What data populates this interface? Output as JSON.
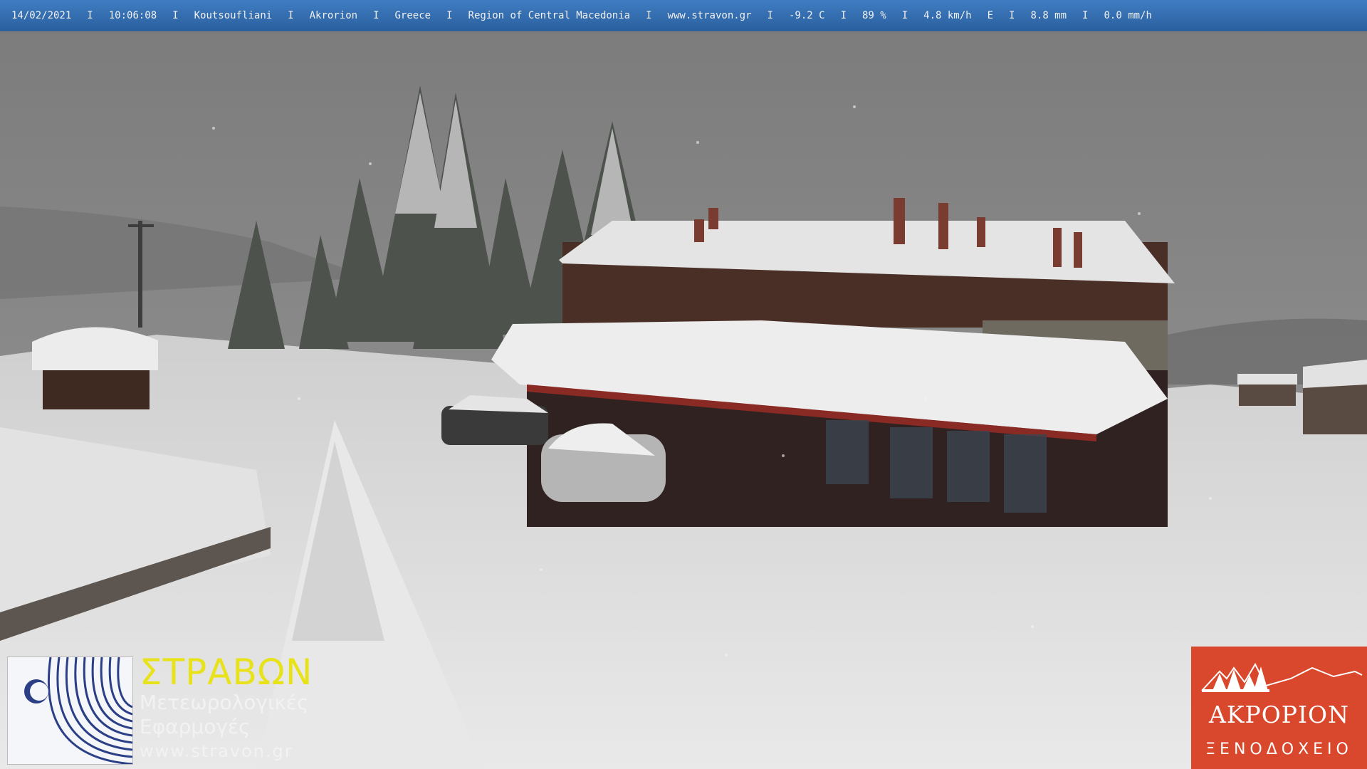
{
  "overlay": {
    "date": "14/02/2021",
    "time": "10:06:08",
    "village": "Koutsoufliani",
    "station": "Akrorion",
    "country": "Greece",
    "region": "Region of Central Macedonia",
    "website": "www.stravon.gr",
    "temperature": "-9.2 C",
    "humidity": "89 %",
    "wind_speed": "4.8 km/h",
    "wind_dir": "E",
    "rain_total": "8.8 mm",
    "rain_rate": "0.0 mm/h",
    "separator": "I",
    "bar_color": "#2f67a8"
  },
  "stravon_logo": {
    "title": "ΣΤΡΑΒΩΝ",
    "line1": "Μετεωρολογικές",
    "line2": "Εφαρμογές",
    "url": "www.stravon.gr",
    "title_color": "#e8e21a"
  },
  "akrorion_logo": {
    "name": "ΑΚΡΟΡΙΟΝ",
    "subtitle": "ΞΕΝΟΔΟΧΕΙΟ",
    "bg_color": "#d9482c"
  }
}
